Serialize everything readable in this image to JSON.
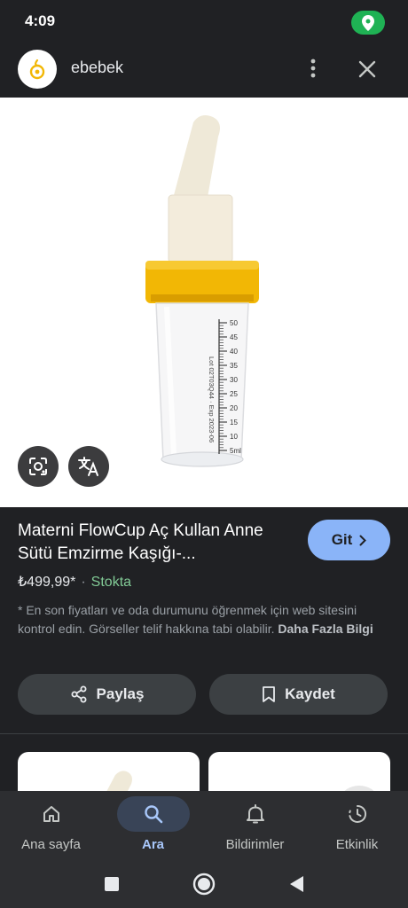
{
  "status": {
    "time": "4:09"
  },
  "header": {
    "site_name": "ebebek"
  },
  "product": {
    "title": "Materni FlowCup Aç Kullan Anne Sütü Emzirme Kaşığı-...",
    "price": "₺499,99*",
    "separator": "·",
    "stock": "Stokta",
    "go_label": "Git",
    "disclaimer": "* En son fiyatları ve oda durumunu öğrenmek için web sitesini kontrol edin. Görseller telif hakkına tabi olabilir.",
    "more_info": "Daha Fazla Bilgi",
    "share_label": "Paylaş",
    "save_label": "Kaydet"
  },
  "image_labels": {
    "scale_marks": [
      "50",
      "45",
      "40",
      "35",
      "30",
      "25",
      "20",
      "15",
      "10",
      "5ml"
    ],
    "lot_text": "Lot 02T03Q44 · Exp 2023-06"
  },
  "nav": {
    "items": [
      {
        "label": "Ana sayfa",
        "icon": "home-icon"
      },
      {
        "label": "Ara",
        "icon": "search-icon"
      },
      {
        "label": "Bildirimler",
        "icon": "bell-icon"
      },
      {
        "label": "Etkinlik",
        "icon": "activity-icon"
      }
    ]
  },
  "colors": {
    "accent": "#8ab4f8",
    "stock": "#81c995",
    "cap": "#f2b705",
    "status_green": "#1fb254"
  }
}
